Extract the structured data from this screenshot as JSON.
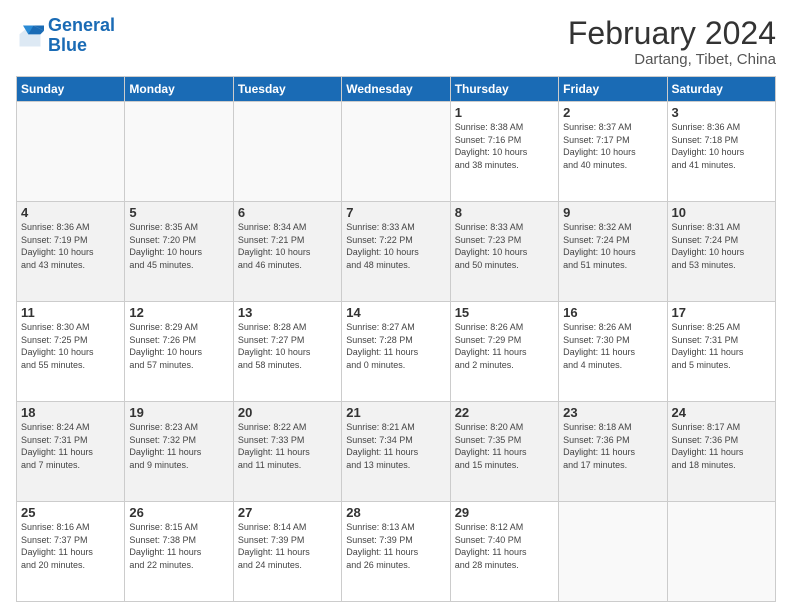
{
  "header": {
    "logo_general": "General",
    "logo_blue": "Blue",
    "title": "February 2024",
    "subtitle": "Dartang, Tibet, China"
  },
  "days_of_week": [
    "Sunday",
    "Monday",
    "Tuesday",
    "Wednesday",
    "Thursday",
    "Friday",
    "Saturday"
  ],
  "weeks": [
    {
      "alt": false,
      "days": [
        {
          "num": "",
          "info": ""
        },
        {
          "num": "",
          "info": ""
        },
        {
          "num": "",
          "info": ""
        },
        {
          "num": "",
          "info": ""
        },
        {
          "num": "1",
          "info": "Sunrise: 8:38 AM\nSunset: 7:16 PM\nDaylight: 10 hours\nand 38 minutes."
        },
        {
          "num": "2",
          "info": "Sunrise: 8:37 AM\nSunset: 7:17 PM\nDaylight: 10 hours\nand 40 minutes."
        },
        {
          "num": "3",
          "info": "Sunrise: 8:36 AM\nSunset: 7:18 PM\nDaylight: 10 hours\nand 41 minutes."
        }
      ]
    },
    {
      "alt": true,
      "days": [
        {
          "num": "4",
          "info": "Sunrise: 8:36 AM\nSunset: 7:19 PM\nDaylight: 10 hours\nand 43 minutes."
        },
        {
          "num": "5",
          "info": "Sunrise: 8:35 AM\nSunset: 7:20 PM\nDaylight: 10 hours\nand 45 minutes."
        },
        {
          "num": "6",
          "info": "Sunrise: 8:34 AM\nSunset: 7:21 PM\nDaylight: 10 hours\nand 46 minutes."
        },
        {
          "num": "7",
          "info": "Sunrise: 8:33 AM\nSunset: 7:22 PM\nDaylight: 10 hours\nand 48 minutes."
        },
        {
          "num": "8",
          "info": "Sunrise: 8:33 AM\nSunset: 7:23 PM\nDaylight: 10 hours\nand 50 minutes."
        },
        {
          "num": "9",
          "info": "Sunrise: 8:32 AM\nSunset: 7:24 PM\nDaylight: 10 hours\nand 51 minutes."
        },
        {
          "num": "10",
          "info": "Sunrise: 8:31 AM\nSunset: 7:24 PM\nDaylight: 10 hours\nand 53 minutes."
        }
      ]
    },
    {
      "alt": false,
      "days": [
        {
          "num": "11",
          "info": "Sunrise: 8:30 AM\nSunset: 7:25 PM\nDaylight: 10 hours\nand 55 minutes."
        },
        {
          "num": "12",
          "info": "Sunrise: 8:29 AM\nSunset: 7:26 PM\nDaylight: 10 hours\nand 57 minutes."
        },
        {
          "num": "13",
          "info": "Sunrise: 8:28 AM\nSunset: 7:27 PM\nDaylight: 10 hours\nand 58 minutes."
        },
        {
          "num": "14",
          "info": "Sunrise: 8:27 AM\nSunset: 7:28 PM\nDaylight: 11 hours\nand 0 minutes."
        },
        {
          "num": "15",
          "info": "Sunrise: 8:26 AM\nSunset: 7:29 PM\nDaylight: 11 hours\nand 2 minutes."
        },
        {
          "num": "16",
          "info": "Sunrise: 8:26 AM\nSunset: 7:30 PM\nDaylight: 11 hours\nand 4 minutes."
        },
        {
          "num": "17",
          "info": "Sunrise: 8:25 AM\nSunset: 7:31 PM\nDaylight: 11 hours\nand 5 minutes."
        }
      ]
    },
    {
      "alt": true,
      "days": [
        {
          "num": "18",
          "info": "Sunrise: 8:24 AM\nSunset: 7:31 PM\nDaylight: 11 hours\nand 7 minutes."
        },
        {
          "num": "19",
          "info": "Sunrise: 8:23 AM\nSunset: 7:32 PM\nDaylight: 11 hours\nand 9 minutes."
        },
        {
          "num": "20",
          "info": "Sunrise: 8:22 AM\nSunset: 7:33 PM\nDaylight: 11 hours\nand 11 minutes."
        },
        {
          "num": "21",
          "info": "Sunrise: 8:21 AM\nSunset: 7:34 PM\nDaylight: 11 hours\nand 13 minutes."
        },
        {
          "num": "22",
          "info": "Sunrise: 8:20 AM\nSunset: 7:35 PM\nDaylight: 11 hours\nand 15 minutes."
        },
        {
          "num": "23",
          "info": "Sunrise: 8:18 AM\nSunset: 7:36 PM\nDaylight: 11 hours\nand 17 minutes."
        },
        {
          "num": "24",
          "info": "Sunrise: 8:17 AM\nSunset: 7:36 PM\nDaylight: 11 hours\nand 18 minutes."
        }
      ]
    },
    {
      "alt": false,
      "days": [
        {
          "num": "25",
          "info": "Sunrise: 8:16 AM\nSunset: 7:37 PM\nDaylight: 11 hours\nand 20 minutes."
        },
        {
          "num": "26",
          "info": "Sunrise: 8:15 AM\nSunset: 7:38 PM\nDaylight: 11 hours\nand 22 minutes."
        },
        {
          "num": "27",
          "info": "Sunrise: 8:14 AM\nSunset: 7:39 PM\nDaylight: 11 hours\nand 24 minutes."
        },
        {
          "num": "28",
          "info": "Sunrise: 8:13 AM\nSunset: 7:39 PM\nDaylight: 11 hours\nand 26 minutes."
        },
        {
          "num": "29",
          "info": "Sunrise: 8:12 AM\nSunset: 7:40 PM\nDaylight: 11 hours\nand 28 minutes."
        },
        {
          "num": "",
          "info": ""
        },
        {
          "num": "",
          "info": ""
        }
      ]
    }
  ]
}
